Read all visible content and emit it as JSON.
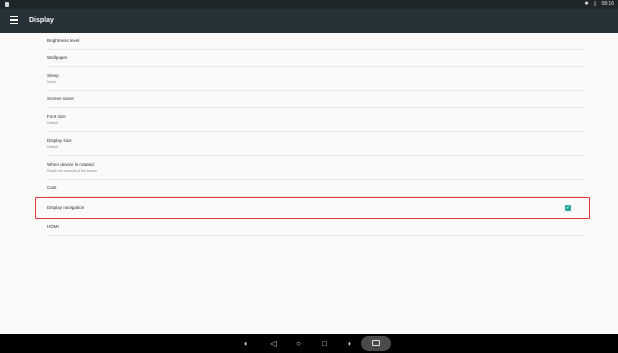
{
  "status_bar": {
    "time": "08:16",
    "icons": [
      "notification-icon",
      "bluetooth-icon",
      "signal-icon"
    ]
  },
  "app_bar": {
    "title": "Display",
    "nav_icon": "menu-icon"
  },
  "settings": {
    "brightness": {
      "title": "Brightness level"
    },
    "wallpaper": {
      "title": "Wallpaper"
    },
    "sleep": {
      "title": "Sleep",
      "summary": "Never"
    },
    "screen_saver": {
      "title": "Screen saver"
    },
    "font_size": {
      "title": "Font size",
      "summary": "Default"
    },
    "display_size": {
      "title": "Display size",
      "summary": "Default"
    },
    "rotation": {
      "title": "When device is rotated",
      "summary": "Rotate the contents of the screen"
    },
    "cast": {
      "title": "Cast"
    },
    "display_navigation": {
      "title": "Display navigation",
      "checked": true
    },
    "hdmi": {
      "title": "HDMI"
    }
  },
  "nav_bar": {
    "buttons": [
      "volume-down-icon",
      "back-icon",
      "home-icon",
      "recents-icon",
      "volume-up-icon",
      "screenshot-icon"
    ]
  },
  "colors": {
    "app_bar": "#263238",
    "status_bar": "#1e2629",
    "checkbox": "#26a69a",
    "highlight": "#e53935"
  }
}
